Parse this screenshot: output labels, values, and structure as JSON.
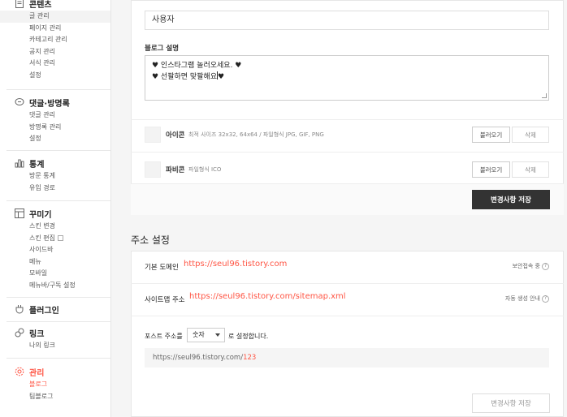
{
  "sidebar": {
    "content": {
      "title": "콘텐츠",
      "items": [
        "글 관리",
        "페이지 관리",
        "카테고리 관리",
        "공지 관리",
        "서식 관리",
        "설정"
      ]
    },
    "comments": {
      "title": "댓글·방명록",
      "items": [
        "댓글 관리",
        "방명록 관리",
        "설정"
      ]
    },
    "stats": {
      "title": "통계",
      "items": [
        "방문 통계",
        "유입 경로"
      ]
    },
    "decorate": {
      "title": "꾸미기",
      "items": [
        "스킨 변경",
        "스킨 편집",
        "사이드바",
        "메뉴",
        "모바일",
        "메뉴바/구독 설정"
      ]
    },
    "plugin": {
      "title": "플러그인"
    },
    "link": {
      "title": "링크",
      "items": [
        "나의 링크"
      ]
    },
    "manage": {
      "title": "관리",
      "items": [
        "블로그",
        "팀블로그"
      ]
    }
  },
  "blog": {
    "author_value": "사용자",
    "desc_label": "블로그 설명",
    "desc_line1": "♥ 인스타그램 놀러오세요. ♥",
    "desc_line2a": "♥  선팔하면 맞팔해요",
    "desc_line2b": "♥",
    "icon_label": "아이콘",
    "icon_hint": "최적 사이즈 32x32, 64x64 / 파일형식 JPG, GIF, PNG",
    "favicon_label": "파비콘",
    "favicon_hint": "파일형식 ICO",
    "load_button": "불러오기",
    "delete_button": "삭제",
    "save_button": "변경사항 저장"
  },
  "address": {
    "heading": "주소 설정",
    "domain_label": "기본 도메인",
    "domain_url": "https://seul96.tistory.com",
    "domain_right": "보안접속 중",
    "sitemap_label": "사이트맵 주소",
    "sitemap_url": "https://seul96.tistory.com/sitemap.xml",
    "sitemap_right": "자동 생성 안내",
    "post_prefix": "포스트 주소를",
    "post_select": "숫자",
    "post_suffix": "로 설정합니다.",
    "url_base": "https://seul96.tistory.com/",
    "url_num": "123",
    "save_button": "변경사항 저장"
  },
  "colors": {
    "accent": "#ff5544",
    "dark_button": "#333333"
  }
}
